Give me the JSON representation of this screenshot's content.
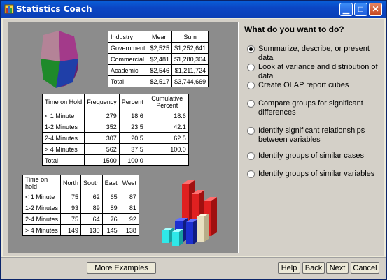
{
  "window": {
    "title": "Statistics Coach"
  },
  "table1": {
    "headers": [
      "Industry",
      "Mean",
      "Sum"
    ],
    "rows": [
      [
        "Government",
        "$2,525",
        "$1,252,641"
      ],
      [
        "Commercial",
        "$2,481",
        "$1,280,304"
      ],
      [
        "Academic",
        "$2,546",
        "$1,211,724"
      ],
      [
        "Total",
        "$2,517",
        "$3,744,669"
      ]
    ]
  },
  "table2": {
    "headers": [
      "Time on Hold",
      "Frequency",
      "Percent",
      "Cumulative Percent"
    ],
    "rows": [
      [
        "< 1 Minute",
        "279",
        "18.6",
        "18.6"
      ],
      [
        "1-2 Minutes",
        "352",
        "23.5",
        "42.1"
      ],
      [
        "2-4 Minutes",
        "307",
        "20.5",
        "62.5"
      ],
      [
        "> 4 Minutes",
        "562",
        "37.5",
        "100.0"
      ],
      [
        "Total",
        "1500",
        "100.0",
        ""
      ]
    ]
  },
  "table3": {
    "headers": [
      "Time on hold",
      "North",
      "South",
      "East",
      "West"
    ],
    "rows": [
      [
        "< 1 Minute",
        "75",
        "62",
        "65",
        "87"
      ],
      [
        "1-2 Minutes",
        "93",
        "89",
        "89",
        "81"
      ],
      [
        "2-4 Minutes",
        "75",
        "64",
        "76",
        "92"
      ],
      [
        "> 4 Minutes",
        "149",
        "130",
        "145",
        "138"
      ]
    ]
  },
  "right": {
    "heading": "What do you want to do?",
    "options": [
      "Summarize, describe, or present data",
      "Look at variance and distribution of data",
      "Create OLAP report cubes",
      "Compare groups for significant differences",
      "Identify significant relationships between variables",
      "Identify groups of similar cases",
      "Identify groups of similar variables"
    ],
    "selected_index": 0
  },
  "buttons": {
    "more_examples": "More Examples",
    "help": "Help",
    "back": "Back",
    "next": "Next",
    "cancel": "Cancel"
  }
}
